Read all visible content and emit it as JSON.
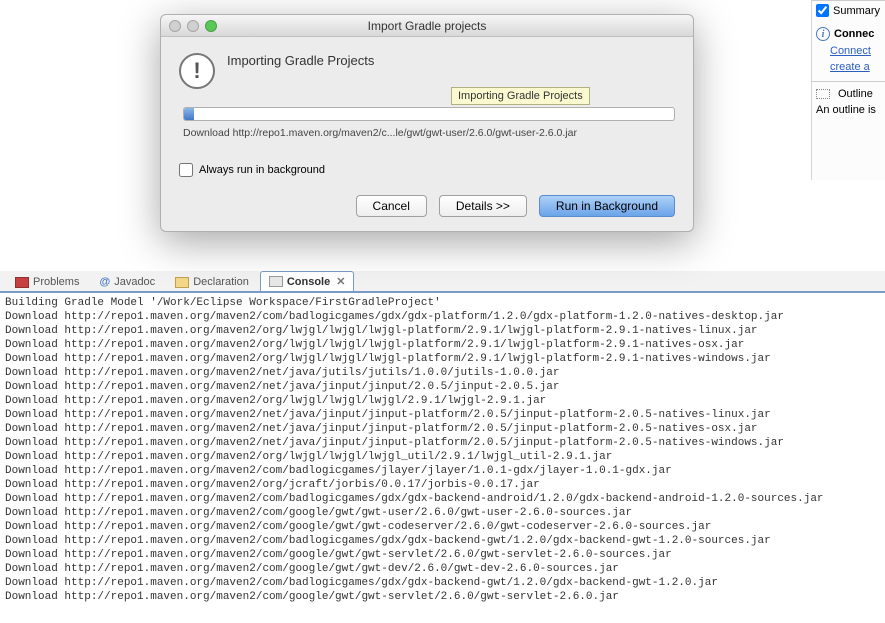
{
  "dialog": {
    "title": "Import Gradle projects",
    "heading": "Importing Gradle Projects",
    "tooltip": "Importing Gradle Projects",
    "status": "Download http://repo1.maven.org/maven2/c...le/gwt/gwt-user/2.6.0/gwt-user-2.6.0.jar",
    "checkbox_label": "Always run in background",
    "buttons": {
      "cancel": "Cancel",
      "details": "Details >>",
      "background": "Run in Background"
    }
  },
  "right": {
    "summary": "Summary",
    "connect": "Connec",
    "connect_link": "Connect",
    "create_text": "create a",
    "outline": "Outline",
    "outline_text": "An outline is"
  },
  "tabs": {
    "problems": "Problems",
    "javadoc": "Javadoc",
    "declaration": "Declaration",
    "console": "Console"
  },
  "console_lines": [
    "Building Gradle Model '/Work/Eclipse Workspace/FirstGradleProject'",
    "Download http://repo1.maven.org/maven2/com/badlogicgames/gdx/gdx-platform/1.2.0/gdx-platform-1.2.0-natives-desktop.jar",
    "Download http://repo1.maven.org/maven2/org/lwjgl/lwjgl/lwjgl-platform/2.9.1/lwjgl-platform-2.9.1-natives-linux.jar",
    "Download http://repo1.maven.org/maven2/org/lwjgl/lwjgl/lwjgl-platform/2.9.1/lwjgl-platform-2.9.1-natives-osx.jar",
    "Download http://repo1.maven.org/maven2/org/lwjgl/lwjgl/lwjgl-platform/2.9.1/lwjgl-platform-2.9.1-natives-windows.jar",
    "Download http://repo1.maven.org/maven2/net/java/jutils/jutils/1.0.0/jutils-1.0.0.jar",
    "Download http://repo1.maven.org/maven2/net/java/jinput/jinput/2.0.5/jinput-2.0.5.jar",
    "Download http://repo1.maven.org/maven2/org/lwjgl/lwjgl/lwjgl/2.9.1/lwjgl-2.9.1.jar",
    "Download http://repo1.maven.org/maven2/net/java/jinput/jinput-platform/2.0.5/jinput-platform-2.0.5-natives-linux.jar",
    "Download http://repo1.maven.org/maven2/net/java/jinput/jinput-platform/2.0.5/jinput-platform-2.0.5-natives-osx.jar",
    "Download http://repo1.maven.org/maven2/net/java/jinput/jinput-platform/2.0.5/jinput-platform-2.0.5-natives-windows.jar",
    "Download http://repo1.maven.org/maven2/org/lwjgl/lwjgl/lwjgl_util/2.9.1/lwjgl_util-2.9.1.jar",
    "Download http://repo1.maven.org/maven2/com/badlogicgames/jlayer/jlayer/1.0.1-gdx/jlayer-1.0.1-gdx.jar",
    "Download http://repo1.maven.org/maven2/org/jcraft/jorbis/0.0.17/jorbis-0.0.17.jar",
    "Download http://repo1.maven.org/maven2/com/badlogicgames/gdx/gdx-backend-android/1.2.0/gdx-backend-android-1.2.0-sources.jar",
    "Download http://repo1.maven.org/maven2/com/google/gwt/gwt-user/2.6.0/gwt-user-2.6.0-sources.jar",
    "Download http://repo1.maven.org/maven2/com/google/gwt/gwt-codeserver/2.6.0/gwt-codeserver-2.6.0-sources.jar",
    "Download http://repo1.maven.org/maven2/com/badlogicgames/gdx/gdx-backend-gwt/1.2.0/gdx-backend-gwt-1.2.0-sources.jar",
    "Download http://repo1.maven.org/maven2/com/google/gwt/gwt-servlet/2.6.0/gwt-servlet-2.6.0-sources.jar",
    "Download http://repo1.maven.org/maven2/com/google/gwt/gwt-dev/2.6.0/gwt-dev-2.6.0-sources.jar",
    "Download http://repo1.maven.org/maven2/com/badlogicgames/gdx/gdx-backend-gwt/1.2.0/gdx-backend-gwt-1.2.0.jar",
    "Download http://repo1.maven.org/maven2/com/google/gwt/gwt-servlet/2.6.0/gwt-servlet-2.6.0.jar"
  ]
}
